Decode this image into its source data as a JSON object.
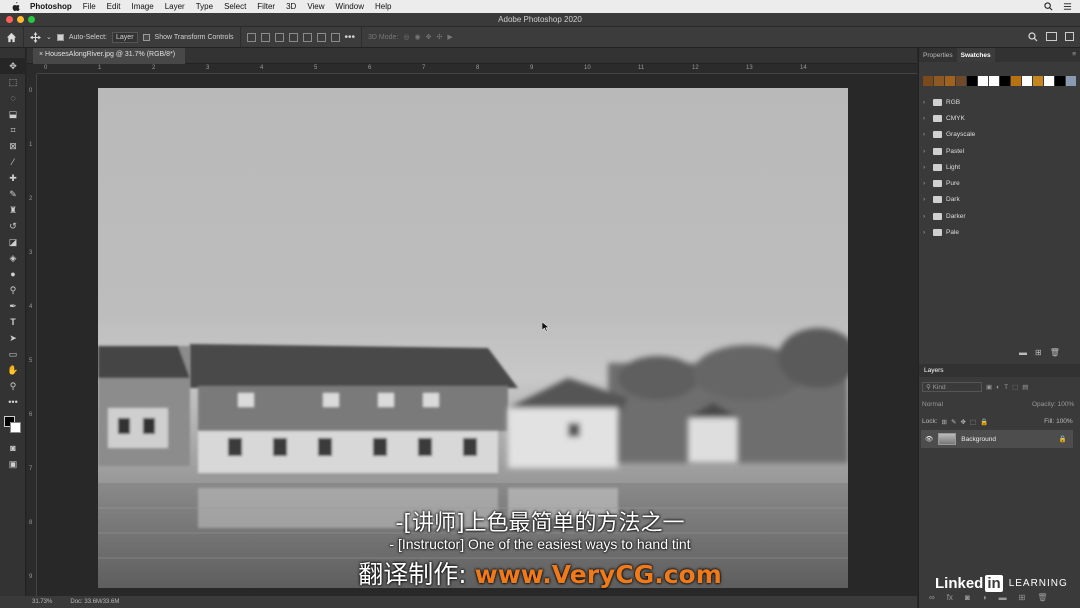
{
  "menubar": {
    "items": [
      "Photoshop",
      "File",
      "Edit",
      "Image",
      "Layer",
      "Type",
      "Select",
      "Filter",
      "3D",
      "View",
      "Window",
      "Help"
    ]
  },
  "window": {
    "title": "Adobe Photoshop 2020"
  },
  "options": {
    "auto_select_label": "Auto-Select:",
    "layer_dropdown": "Layer",
    "transform_label": "Show Transform Controls",
    "mode_3d_label": "3D Mode:"
  },
  "document": {
    "tab_label": "HousesAlongRiver.jpg @ 31.7% (RGB/8*)",
    "h_ruler": [
      "0",
      "1",
      "2",
      "3",
      "4",
      "5",
      "6",
      "7",
      "8",
      "9",
      "10",
      "11",
      "12",
      "13",
      "14"
    ],
    "v_ruler": [
      "0",
      "1",
      "2",
      "3",
      "4",
      "5",
      "6",
      "7",
      "8",
      "9"
    ]
  },
  "status": {
    "zoom": "31.73%",
    "doc": "Doc: 33.6M/33.6M"
  },
  "panels": {
    "tabs": [
      "Properties",
      "Swatches"
    ],
    "swatch_colors": [
      "#7a4a1c",
      "#8b5a24",
      "#a0621e",
      "#6e4a2a",
      "#000000",
      "#ffffff",
      "#ffffff",
      "#000000",
      "#b8720f",
      "#ffffff",
      "#c7851f",
      "#ffffff",
      "#000000",
      "#8a9ab0"
    ],
    "folders": [
      "RGB",
      "CMYK",
      "Grayscale",
      "Pastel",
      "Light",
      "Pure",
      "Dark",
      "Darker",
      "Pale"
    ]
  },
  "layers": {
    "title": "Layers",
    "kind_label": "Kind",
    "blend_mode": "Normal",
    "opacity_label": "Opacity:",
    "opacity_value": "100%",
    "lock_label": "Lock:",
    "fill_label": "Fill:",
    "fill_value": "100%",
    "background_layer": "Background"
  },
  "subtitles": {
    "line1": "-[讲师]上色最简单的方法之一",
    "line2": "- [Instructor] One of the easiest ways to hand tint",
    "line3_label": "翻译制作: ",
    "line3_url": "www.VeryCG.com"
  },
  "watermark": {
    "brand": "Linked",
    "brand_in": "in",
    "learning": "LEARNING"
  }
}
